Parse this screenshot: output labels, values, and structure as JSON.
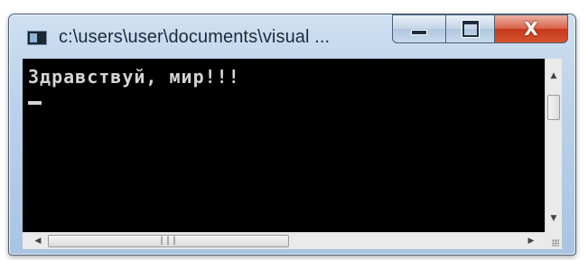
{
  "window": {
    "title": "c:\\users\\user\\documents\\visual ...",
    "close_glyph": "X"
  },
  "console": {
    "lines": [
      "Здравствуй, мир!!!"
    ]
  },
  "scrollbars": {
    "vertical": {
      "up_arrow": "▲",
      "down_arrow": "▼",
      "position": 0.0
    },
    "horizontal": {
      "left_arrow": "◀",
      "right_arrow": "▶",
      "grip": "|||",
      "position": 0.0
    }
  },
  "icons": [
    "console-app-icon",
    "minimize-icon",
    "maximize-icon",
    "close-icon"
  ],
  "colors": {
    "console_bg": "#000000",
    "console_text": "#d4d4d4",
    "close_button": "#c4381c"
  }
}
